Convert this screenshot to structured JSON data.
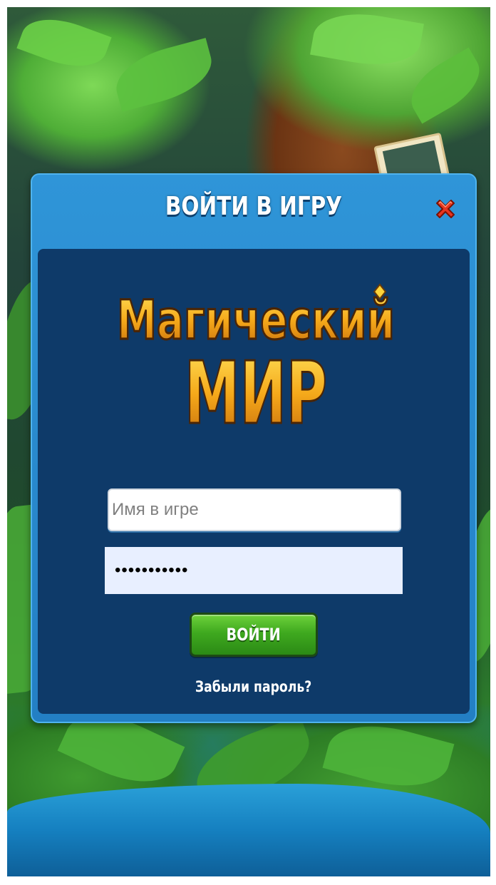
{
  "dialog": {
    "title": "ВОЙТИ В ИГРУ",
    "close_icon": "close-icon"
  },
  "logo": {
    "line1": "Магический",
    "line2": "МИР"
  },
  "form": {
    "username_placeholder": "Имя в игре",
    "username_value": "",
    "password_value": "•••••••••••",
    "login_label": "ВОЙТИ",
    "forgot_label": "Забыли пароль?"
  },
  "colors": {
    "dialog_frame": "#2f95d8",
    "panel": "#0e3a69",
    "button_green": "#3fa91f",
    "close_red": "#e8351f",
    "logo_gold": "#f2b21c"
  }
}
